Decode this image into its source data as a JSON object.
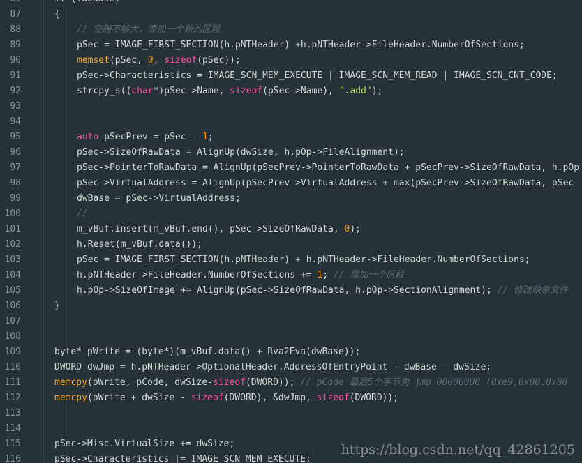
{
  "editor": {
    "colors": {
      "background": "#263238",
      "plain": "#d4d4d4",
      "keyword": "#f94fa0",
      "function": "#f6a623",
      "number": "#ff8c00",
      "string": "#b8d84a",
      "comment": "#5c6b73",
      "line_number": "#8a9599"
    },
    "lines": [
      {
        "num": "86",
        "indent": 1,
        "tokens": [
          {
            "t": "if (!dwBase)",
            "c": "plain"
          }
        ]
      },
      {
        "num": "87",
        "indent": 1,
        "tokens": [
          {
            "t": "{",
            "c": "plain"
          }
        ]
      },
      {
        "num": "88",
        "indent": 2,
        "tokens": [
          {
            "t": "// 空隙不够大，添加一个新的区段",
            "c": "comment"
          }
        ]
      },
      {
        "num": "89",
        "indent": 2,
        "tokens": [
          {
            "t": "pSec = IMAGE_FIRST_SECTION(h.pNTHeader) +h.pNTHeader->FileHeader.NumberOfSections;",
            "c": "plain"
          }
        ]
      },
      {
        "num": "90",
        "indent": 2,
        "tokens": [
          {
            "t": "memset",
            "c": "func"
          },
          {
            "t": "(pSec, ",
            "c": "plain"
          },
          {
            "t": "0",
            "c": "number"
          },
          {
            "t": ", ",
            "c": "plain"
          },
          {
            "t": "sizeof",
            "c": "keyword"
          },
          {
            "t": "(pSec));",
            "c": "plain"
          }
        ]
      },
      {
        "num": "91",
        "indent": 2,
        "tokens": [
          {
            "t": "pSec->Characteristics = IMAGE_SCN_MEM_EXECUTE | IMAGE_SCN_MEM_READ | IMAGE_SCN_CNT_CODE;",
            "c": "plain"
          }
        ]
      },
      {
        "num": "92",
        "indent": 2,
        "tokens": [
          {
            "t": "strcpy_s((",
            "c": "plain"
          },
          {
            "t": "char",
            "c": "keyword"
          },
          {
            "t": "*)pSec->Name, ",
            "c": "plain"
          },
          {
            "t": "sizeof",
            "c": "keyword"
          },
          {
            "t": "(pSec->Name), ",
            "c": "plain"
          },
          {
            "t": "\".add\"",
            "c": "string"
          },
          {
            "t": ");",
            "c": "plain"
          }
        ]
      },
      {
        "num": "93",
        "indent": 0,
        "tokens": []
      },
      {
        "num": "94",
        "indent": 0,
        "tokens": []
      },
      {
        "num": "95",
        "indent": 2,
        "tokens": [
          {
            "t": "auto",
            "c": "keyword"
          },
          {
            "t": " pSecPrev = pSec - ",
            "c": "plain"
          },
          {
            "t": "1",
            "c": "number"
          },
          {
            "t": ";",
            "c": "plain"
          }
        ]
      },
      {
        "num": "96",
        "indent": 2,
        "tokens": [
          {
            "t": "pSec->SizeOfRawData = AlignUp(dwSize, h.pOp->FileAlignment);",
            "c": "plain"
          }
        ]
      },
      {
        "num": "97",
        "indent": 2,
        "tokens": [
          {
            "t": "pSec->PointerToRawData = AlignUp(pSecPrev->PointerToRawData + pSecPrev->SizeOfRawData, h.pOp",
            "c": "plain"
          }
        ]
      },
      {
        "num": "98",
        "indent": 2,
        "tokens": [
          {
            "t": "pSec->VirtualAddress = AlignUp(pSecPrev->VirtualAddress + max(pSecPrev->SizeOfRawData, pSec",
            "c": "plain"
          }
        ]
      },
      {
        "num": "99",
        "indent": 2,
        "tokens": [
          {
            "t": "dwBase = pSec->VirtualAddress;",
            "c": "plain"
          }
        ]
      },
      {
        "num": "100",
        "indent": 2,
        "tokens": [
          {
            "t": "//",
            "c": "comment"
          }
        ]
      },
      {
        "num": "101",
        "indent": 2,
        "tokens": [
          {
            "t": "m_vBuf.insert(m_vBuf.end(), pSec->SizeOfRawData, ",
            "c": "plain"
          },
          {
            "t": "0",
            "c": "number"
          },
          {
            "t": ");",
            "c": "plain"
          }
        ]
      },
      {
        "num": "102",
        "indent": 2,
        "tokens": [
          {
            "t": "h.Reset(m_vBuf.data());",
            "c": "plain"
          }
        ]
      },
      {
        "num": "103",
        "indent": 2,
        "tokens": [
          {
            "t": "pSec = IMAGE_FIRST_SECTION(h.pNTHeader) + h.pNTHeader->FileHeader.NumberOfSections;",
            "c": "plain"
          }
        ]
      },
      {
        "num": "104",
        "indent": 2,
        "tokens": [
          {
            "t": "h.pNTHeader->FileHeader.NumberOfSections += ",
            "c": "plain"
          },
          {
            "t": "1",
            "c": "number"
          },
          {
            "t": "; ",
            "c": "plain"
          },
          {
            "t": "// 增加一个区段",
            "c": "comment"
          }
        ]
      },
      {
        "num": "105",
        "indent": 2,
        "tokens": [
          {
            "t": "h.pOp->SizeOfImage += AlignUp(pSec->SizeOfRawData, h.pOp->SectionAlignment); ",
            "c": "plain"
          },
          {
            "t": "// 修改映象文件",
            "c": "comment"
          }
        ]
      },
      {
        "num": "106",
        "indent": 1,
        "tokens": [
          {
            "t": "}",
            "c": "plain"
          }
        ]
      },
      {
        "num": "107",
        "indent": 0,
        "tokens": []
      },
      {
        "num": "108",
        "indent": 0,
        "tokens": []
      },
      {
        "num": "109",
        "indent": 1,
        "tokens": [
          {
            "t": "byte* pWrite = (byte*)(m_vBuf.data() + Rva2Fva(dwBase));",
            "c": "plain"
          }
        ]
      },
      {
        "num": "110",
        "indent": 1,
        "tokens": [
          {
            "t": "DWORD dwJmp = h.pNTHeader->OptionalHeader.AddressOfEntryPoint - dwBase - dwSize;",
            "c": "plain"
          }
        ]
      },
      {
        "num": "111",
        "indent": 1,
        "tokens": [
          {
            "t": "memcpy",
            "c": "func"
          },
          {
            "t": "(pWrite, pCode, dwSize-",
            "c": "plain"
          },
          {
            "t": "sizeof",
            "c": "keyword"
          },
          {
            "t": "(DWORD)); ",
            "c": "plain"
          },
          {
            "t": "// pCode 最后5个字节为 jmp 00000000 (0xe9,0x00,0x00",
            "c": "comment"
          }
        ]
      },
      {
        "num": "112",
        "indent": 1,
        "tokens": [
          {
            "t": "memcpy",
            "c": "func"
          },
          {
            "t": "(pWrite + dwSize - ",
            "c": "plain"
          },
          {
            "t": "sizeof",
            "c": "keyword"
          },
          {
            "t": "(DWORD), &dwJmp, ",
            "c": "plain"
          },
          {
            "t": "sizeof",
            "c": "keyword"
          },
          {
            "t": "(DWORD));",
            "c": "plain"
          }
        ]
      },
      {
        "num": "113",
        "indent": 0,
        "tokens": []
      },
      {
        "num": "114",
        "indent": 0,
        "tokens": []
      },
      {
        "num": "115",
        "indent": 1,
        "tokens": [
          {
            "t": "pSec->Misc.VirtualSize += dwSize;",
            "c": "plain"
          }
        ]
      },
      {
        "num": "116",
        "indent": 1,
        "tokens": [
          {
            "t": "pSec->Characteristics |= IMAGE_SCN_MEM_EXECUTE;",
            "c": "plain"
          }
        ]
      }
    ]
  },
  "watermark": {
    "text": "https://blog.csdn.net/qq_42861205"
  }
}
